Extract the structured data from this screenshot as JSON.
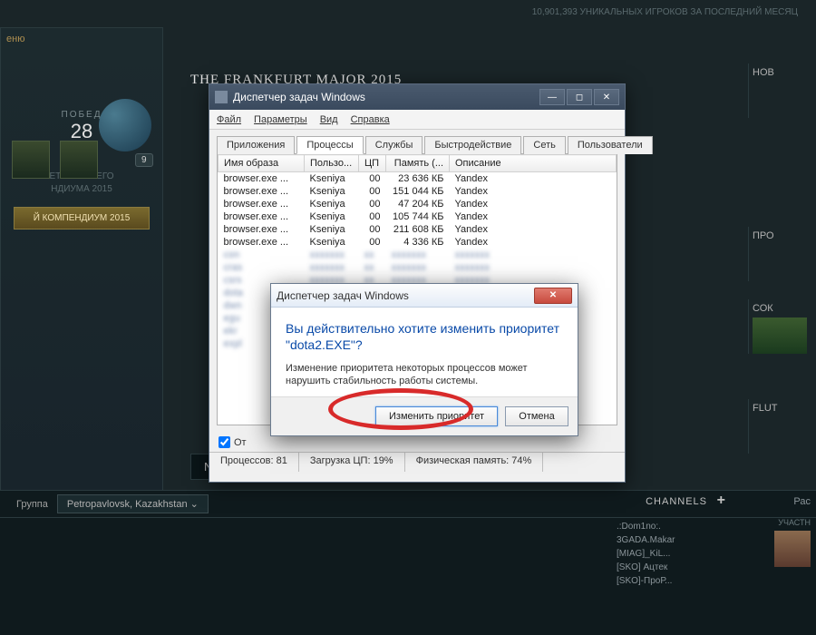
{
  "topbar": {
    "players_stat": "10,901,393  УНИКАЛЬНЫХ ИГРОКОВ ЗА ПОСЛЕДНИЙ МЕСЯЦ"
  },
  "section_title": "THE FRANKFURT MAJOR 2015",
  "left_panel": {
    "menu_label": "еню",
    "badge": "9",
    "wins_label": "ПОБЕД",
    "wins_value": "28",
    "compendium_line1": "ЕТ ОСЕННЕГО",
    "compendium_line2": "НДИУМА 2015",
    "compendium_btn": "Й КОМПЕНДИУМ 2015"
  },
  "next_label": "Next",
  "right_col": {
    "r1": "НОВ",
    "r2": "ПРО",
    "r3": "СОК",
    "r4": "FLUT",
    "r5": "Рас",
    "participants": "УЧАСТН"
  },
  "chat": {
    "group_tab": "Группа",
    "location": "Petropavlovsk, Kazakhstan",
    "channels_label": "CHANNELS",
    "members": [
      "   ",
      ".:Dom1no:.",
      "3GADA.Makar",
      "[MIAG]_KiL...",
      "[SKO] Ацтек",
      "[SKO]-ПроР..."
    ]
  },
  "taskmgr": {
    "title": "Диспетчер задач Windows",
    "menu": {
      "file": "Файл",
      "options": "Параметры",
      "view": "Вид",
      "help": "Справка"
    },
    "tabs": [
      "Приложения",
      "Процессы",
      "Службы",
      "Быстродействие",
      "Сеть",
      "Пользователи"
    ],
    "active_tab_index": 1,
    "columns": [
      "Имя образа",
      "Пользо...",
      "ЦП",
      "Память (...",
      "Описание"
    ],
    "rows": [
      {
        "name": "browser.exe ...",
        "user": "Kseniya",
        "cpu": "00",
        "mem": "23 636 КБ",
        "desc": "Yandex"
      },
      {
        "name": "browser.exe ...",
        "user": "Kseniya",
        "cpu": "00",
        "mem": "151 044 КБ",
        "desc": "Yandex"
      },
      {
        "name": "browser.exe ...",
        "user": "Kseniya",
        "cpu": "00",
        "mem": "47 204 КБ",
        "desc": "Yandex"
      },
      {
        "name": "browser.exe ...",
        "user": "Kseniya",
        "cpu": "00",
        "mem": "105 744 КБ",
        "desc": "Yandex"
      },
      {
        "name": "browser.exe ...",
        "user": "Kseniya",
        "cpu": "00",
        "mem": "211 608 КБ",
        "desc": "Yandex"
      },
      {
        "name": "browser.exe ...",
        "user": "Kseniya",
        "cpu": "00",
        "mem": "4 336 КБ",
        "desc": "Yandex"
      }
    ],
    "blurred_prefixes": [
      "con",
      "cras",
      "csrs",
      "dota",
      "dwn",
      "egu",
      "ekr",
      "expl"
    ],
    "show_all_label": "От",
    "status": {
      "processes": "Процессов: 81",
      "cpu": "Загрузка ЦП: 19%",
      "mem": "Физическая память: 74%"
    }
  },
  "dialog": {
    "title": "Диспетчер задач Windows",
    "main_text": "Вы действительно хотите изменить приоритет \"dota2.EXE\"?",
    "sub_text": "Изменение приоритета некоторых процессов может нарушить стабильность работы системы.",
    "ok": "Изменить приоритет",
    "cancel": "Отмена"
  }
}
